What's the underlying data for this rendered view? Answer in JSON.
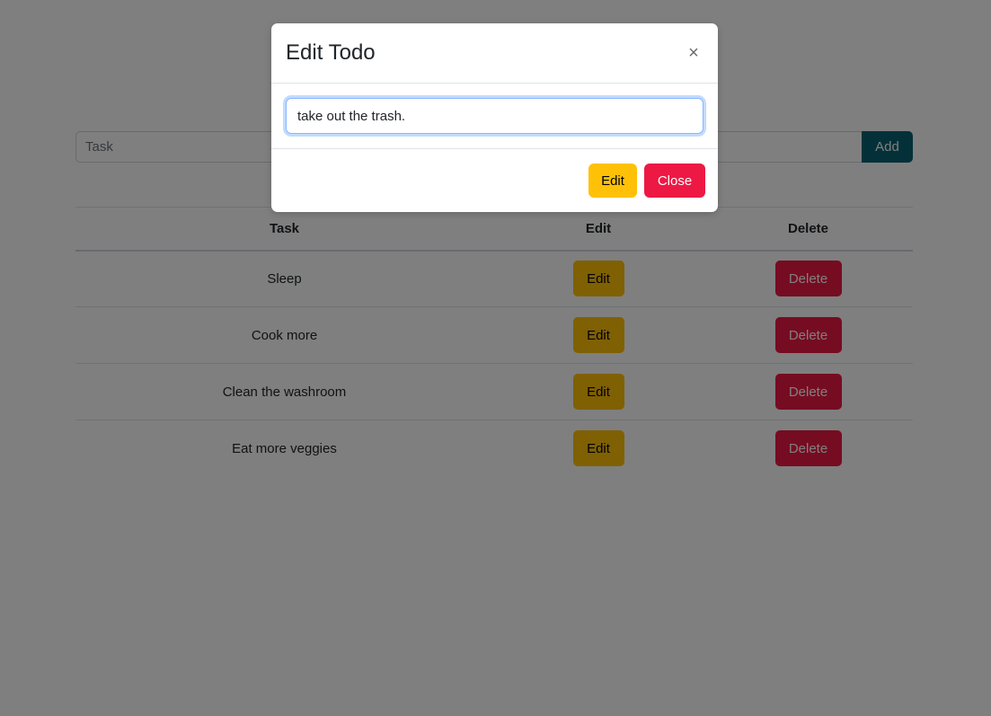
{
  "colors": {
    "add_button": "#086272",
    "edit_button": "#ffc107",
    "delete_button": "#ed1944",
    "backdrop": "#808080",
    "focus_border": "#86b7fe"
  },
  "app": {
    "task_input": {
      "value": "",
      "placeholder": "Task"
    },
    "add_button_label": "Add",
    "table": {
      "headers": [
        "Task",
        "Edit",
        "Delete"
      ],
      "rows": [
        {
          "task": "Sleep",
          "edit_label": "Edit",
          "delete_label": "Delete"
        },
        {
          "task": "Cook more",
          "edit_label": "Edit",
          "delete_label": "Delete"
        },
        {
          "task": "Clean the washroom",
          "edit_label": "Edit",
          "delete_label": "Delete"
        },
        {
          "task": "Eat more veggies",
          "edit_label": "Edit",
          "delete_label": "Delete"
        }
      ]
    }
  },
  "modal": {
    "title": "Edit Todo",
    "close_icon": "×",
    "input": {
      "value": "take out the trash.",
      "placeholder": ""
    },
    "edit_button_label": "Edit",
    "close_button_label": "Close"
  }
}
